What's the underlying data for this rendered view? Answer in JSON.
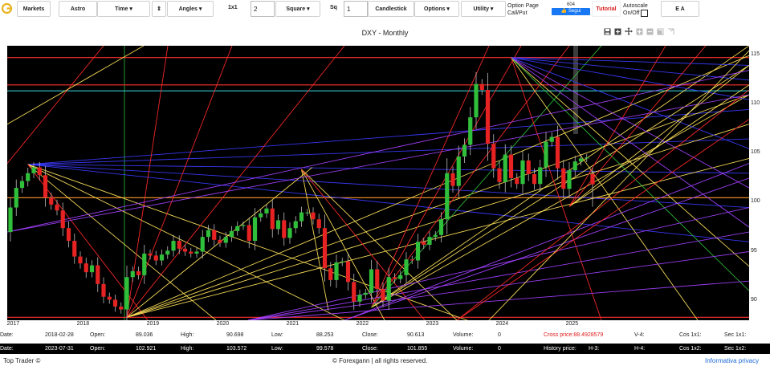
{
  "toolbar": {
    "markets": "Markets",
    "astro": "Astro",
    "time": "Time ▾",
    "updown": "⇕",
    "angles": "Angles ▾",
    "ratio_label": "1x1",
    "ratio_value": "2",
    "square": "Square ▾",
    "sq_label": "Sq",
    "sq_value": "1",
    "candlestick": "Candlestick",
    "options": "Options ▾",
    "utility": "Utility ▾",
    "option_page_1": "Option Page",
    "option_page_2": "Call/Put",
    "follow_count": "604",
    "follow_label": "Segui",
    "tutorial": "Tutorial",
    "autoscale_1": "Autoscale",
    "autoscale_2": "On/Off",
    "ea": "E A"
  },
  "chart_title": "DXY - Monthly",
  "chart_data": {
    "type": "candlestick",
    "title": "DXY - Monthly",
    "x_ticks": [
      "2017",
      "2018",
      "2019",
      "2020",
      "2021",
      "2022",
      "2023",
      "2024",
      "2025"
    ],
    "y_ticks": [
      "115",
      "110",
      "105",
      "100",
      "95",
      "90"
    ],
    "ylim": [
      88,
      116
    ],
    "horizontal_levels": [
      {
        "value": 114.8,
        "color": "#ff3030"
      },
      {
        "value": 112.0,
        "color": "#ff3030"
      },
      {
        "value": 111.4,
        "color": "#33c6d0"
      },
      {
        "value": 100.5,
        "color": "#ff9a2a"
      },
      {
        "value": 88.3,
        "color": "#ff3030"
      }
    ],
    "vertical_marker_year": "2018",
    "closes": [
      99.5,
      101.5,
      102.2,
      103.0,
      103.6,
      102.8,
      100.5,
      99.8,
      99.2,
      97.4,
      96.1,
      94.5,
      93.8,
      92.9,
      93.6,
      91.7,
      90.4,
      90.1,
      89.4,
      89.1,
      92.4,
      93.0,
      92.6,
      94.8,
      94.6,
      94.1,
      94.7,
      95.1,
      96.1,
      95.3,
      95.0,
      94.8,
      95.0,
      96.5,
      97.2,
      96.2,
      95.9,
      96.5,
      97.1,
      97.6,
      97.7,
      96.1,
      98.5,
      98.9,
      99.4,
      97.3,
      98.2,
      96.4,
      97.4,
      98.1,
      99.0,
      99.0,
      98.3,
      97.4,
      93.3,
      92.1,
      93.9,
      94.0,
      91.9,
      89.9,
      90.6,
      90.8,
      93.2,
      91.2,
      90.0,
      92.4,
      92.2,
      92.6,
      94.2,
      94.1,
      96.0,
      95.7,
      96.5,
      96.7,
      98.3,
      103.0,
      101.7,
      104.7,
      105.9,
      108.7,
      112.1,
      111.5,
      106.0,
      103.5,
      102.1,
      104.9,
      102.5,
      101.9,
      104.3,
      102.9,
      101.9,
      103.6,
      106.2,
      106.7,
      103.5,
      101.4,
      103.3,
      104.2,
      104.5,
      104.6,
      102.5
    ],
    "last_candle": {
      "open": 102.921,
      "high": 103.572,
      "low": 99.578,
      "close": 101.855
    }
  },
  "info": {
    "row1": {
      "date_label": "Date:",
      "date": "2018-02-28",
      "open_label": "Open:",
      "open": "89.036",
      "high_label": "High:",
      "high": "90.698",
      "low_label": "Low:",
      "low": "88.253",
      "close_label": "Close:",
      "close": "90.613",
      "volume_label": "Volume:",
      "volume": "0",
      "cross_price": "Cross price:88.4928579",
      "v4": "V-4:",
      "cos": "Cos 1x1:",
      "sec": "Sec 1x1:"
    },
    "row2": {
      "date_label": "Date:",
      "date": "2023-07-31",
      "open_label": "Open:",
      "open": "102.921",
      "high_label": "High:",
      "high": "103.572",
      "low_label": "Low:",
      "low": "99.578",
      "close_label": "Close:",
      "close": "101.855",
      "volume_label": "Volume:",
      "volume": "0",
      "history_price": "History price:",
      "h3": "H-3:",
      "h4": "H-4:",
      "cos": "Cos 1x2:",
      "sec": "Sec 1x2:"
    }
  },
  "footer": {
    "left": "Top Trader ©",
    "center": "© Forexgann | all rights reserved.",
    "right": "Informativa privacy"
  },
  "colors": {
    "bull": "#2fbf3a",
    "bear": "#e62222",
    "link": "#1e6bd6"
  }
}
